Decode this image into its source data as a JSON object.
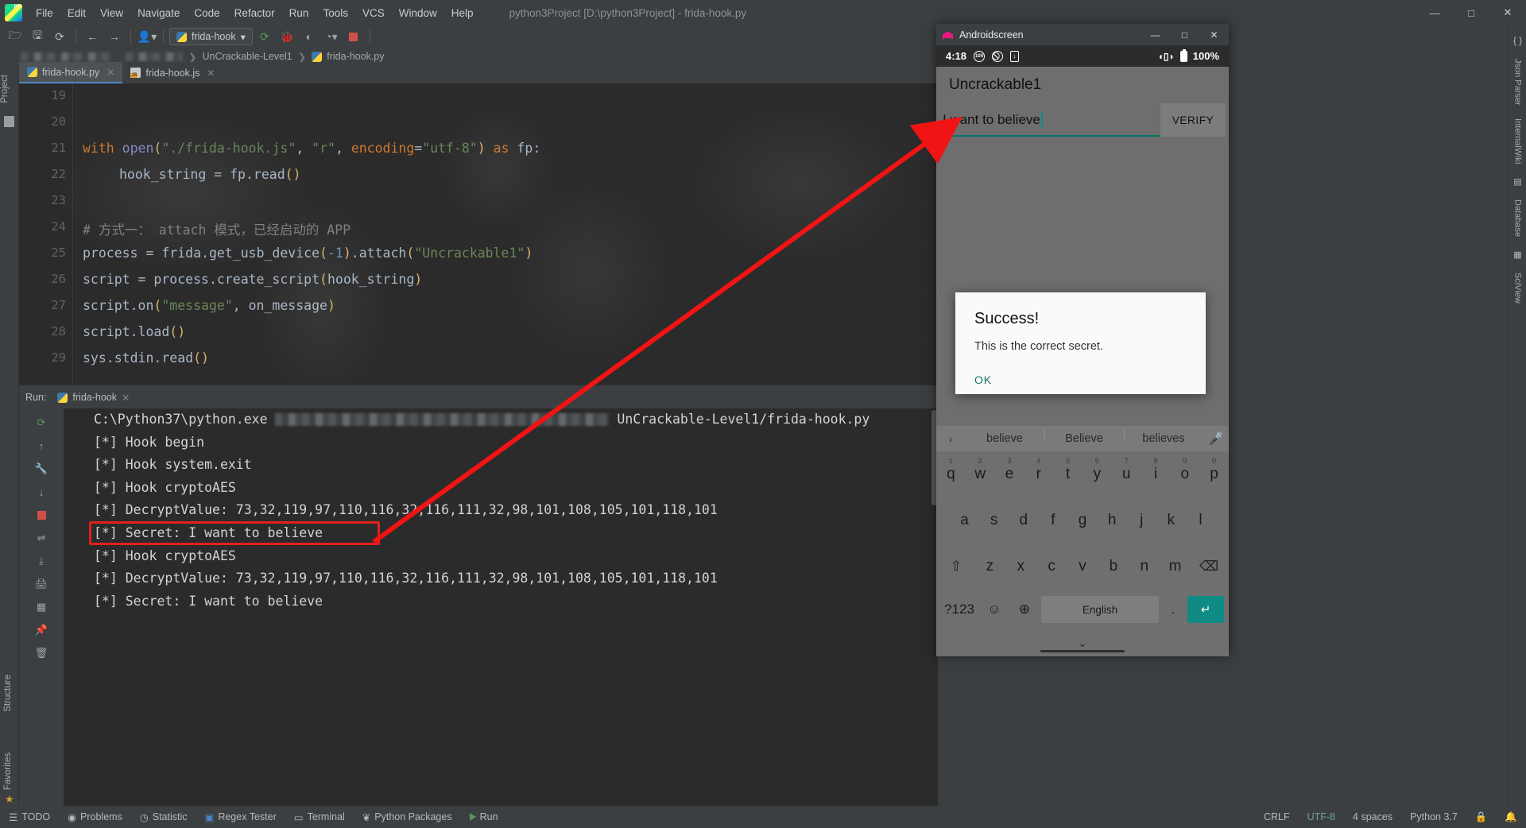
{
  "ide": {
    "window_title": "python3Project [D:\\python3Project] - frida-hook.py",
    "menus": [
      "File",
      "Edit",
      "View",
      "Navigate",
      "Code",
      "Refactor",
      "Run",
      "Tools",
      "VCS",
      "Window",
      "Help"
    ],
    "window_controls": {
      "minimize": "—",
      "maximize": "□",
      "close": "✕"
    },
    "toolbar": {
      "open_icon": "open-folder-icon",
      "save_icon": "save-icon",
      "sync_icon": "sync-icon",
      "back_icon": "←",
      "forward_icon": "→",
      "profile_icon": "▴",
      "run_config_label": "frida-hook",
      "dropdown_caret": "▾",
      "rerun_icon": "↻",
      "debug_icon": "debug-bug-icon",
      "coverage_icon": "coverage-icon",
      "profile_run_icon": "▶",
      "stop_icon": "stop-icon"
    },
    "breadcrumb": {
      "segment": "UnCrackable-Level1",
      "file": "frida-hook.py",
      "separator": "❯"
    },
    "tabs": [
      {
        "label": "frida-hook.py",
        "icon": "python-file-icon",
        "active": true,
        "close": "✕"
      },
      {
        "label": "frida-hook.js",
        "icon": "javascript-file-icon",
        "active": false,
        "close": "✕"
      }
    ],
    "left_strip": {
      "project_label": "Project",
      "structure_label": "Structure",
      "favorites_label": "Favorites"
    },
    "right_strip": [
      "Json Parser",
      "InternalWiki",
      "Database",
      "SciView"
    ],
    "editor": {
      "lines": [
        {
          "no": "19",
          "tokens": []
        },
        {
          "no": "20",
          "tokens": []
        },
        {
          "no": "21",
          "tokens": [
            {
              "t": "with ",
              "c": "k"
            },
            {
              "t": "open",
              "c": "fn"
            },
            {
              "t": "(",
              "c": "par"
            },
            {
              "t": "\"./frida-hook.js\"",
              "c": "s"
            },
            {
              "t": ", ",
              "c": "p"
            },
            {
              "t": "\"r\"",
              "c": "s"
            },
            {
              "t": ", ",
              "c": "p"
            },
            {
              "t": "encoding",
              "c": "k"
            },
            {
              "t": "=",
              "c": "p"
            },
            {
              "t": "\"utf-8\"",
              "c": "s"
            },
            {
              "t": ")",
              "c": "par"
            },
            {
              "t": " ",
              "c": "p"
            },
            {
              "t": "as ",
              "c": "k"
            },
            {
              "t": "fp",
              "c": "p"
            },
            {
              "t": ":",
              "c": "p"
            }
          ]
        },
        {
          "no": "22",
          "indent": 1,
          "tokens": [
            {
              "t": "hook_string ",
              "c": "p"
            },
            {
              "t": "= ",
              "c": "p"
            },
            {
              "t": "fp.read",
              "c": "p"
            },
            {
              "t": "()",
              "c": "par"
            }
          ]
        },
        {
          "no": "23",
          "tokens": []
        },
        {
          "no": "24",
          "tokens": [
            {
              "t": "# 方式一： attach 模式，已经启动的 APP",
              "c": "c"
            }
          ]
        },
        {
          "no": "25",
          "tokens": [
            {
              "t": "process ",
              "c": "p"
            },
            {
              "t": "= ",
              "c": "p"
            },
            {
              "t": "frida.get_usb_device",
              "c": "p"
            },
            {
              "t": "(",
              "c": "par"
            },
            {
              "t": "-1",
              "c": "n"
            },
            {
              "t": ")",
              "c": "par"
            },
            {
              "t": ".attach",
              "c": "p"
            },
            {
              "t": "(",
              "c": "par"
            },
            {
              "t": "\"Uncrackable1\"",
              "c": "s"
            },
            {
              "t": ")",
              "c": "par"
            }
          ]
        },
        {
          "no": "26",
          "tokens": [
            {
              "t": "script ",
              "c": "p"
            },
            {
              "t": "= ",
              "c": "p"
            },
            {
              "t": "process.create_script",
              "c": "p"
            },
            {
              "t": "(",
              "c": "par"
            },
            {
              "t": "hook_string",
              "c": "p"
            },
            {
              "t": ")",
              "c": "par"
            }
          ]
        },
        {
          "no": "27",
          "tokens": [
            {
              "t": "script.on",
              "c": "p"
            },
            {
              "t": "(",
              "c": "par"
            },
            {
              "t": "\"message\"",
              "c": "s"
            },
            {
              "t": ", ",
              "c": "p"
            },
            {
              "t": "on_message",
              "c": "p"
            },
            {
              "t": ")",
              "c": "par"
            }
          ]
        },
        {
          "no": "28",
          "tokens": [
            {
              "t": "script.load",
              "c": "p"
            },
            {
              "t": "()",
              "c": "par"
            }
          ]
        },
        {
          "no": "29",
          "tokens": [
            {
              "t": "sys.stdin.read",
              "c": "p"
            },
            {
              "t": "()",
              "c": "par"
            }
          ]
        }
      ]
    },
    "run_panel": {
      "label": "Run:",
      "tab_label": "frida-hook",
      "tab_close": "✕",
      "tool_icons": [
        "rerun-icon",
        "scroll-up-icon",
        "wrench-icon",
        "scroll-down-icon",
        "stop-icon",
        "soft-wrap-icon",
        "scroll-to-end-icon",
        "print-icon",
        "layout-icon",
        "pin-icon",
        "trash-icon"
      ],
      "console_lines": [
        {
          "text": "C:\\Python37\\python.exe ",
          "blurred": true,
          "tail": "UnCrackable-Level1/frida-hook.py"
        },
        {
          "text": "[*] Hook begin"
        },
        {
          "text": "[*] Hook system.exit"
        },
        {
          "text": "[*] Hook cryptoAES"
        },
        {
          "text": "[*] DecryptValue: 73,32,119,97,110,116,32,116,111,32,98,101,108,105,101,118,101"
        },
        {
          "text": "[*] Secret: I want to believe",
          "highlight": true
        },
        {
          "text": "[*] Hook cryptoAES"
        },
        {
          "text": "[*] DecryptValue: 73,32,119,97,110,116,32,116,111,32,98,101,108,105,101,118,101"
        },
        {
          "text": "[*] Secret: I want to believe"
        }
      ],
      "highlight_color": "#e41f1f"
    },
    "status_bar": {
      "todo": "TODO",
      "problems": "Problems",
      "statistic": "Statistic",
      "regex_tester": "Regex Tester",
      "terminal": "Terminal",
      "python_packages": "Python Packages",
      "run": "Run",
      "line_sep": "CRLF",
      "encoding": "UTF-8",
      "indent": "4 spaces",
      "interpreter": "Python 3.7",
      "lock_icon": "lock-icon",
      "notification_icon": "bell-icon"
    }
  },
  "android": {
    "window_title": "Androidscreen",
    "window_controls": {
      "minimize": "—",
      "maximize": "□",
      "close": "✕"
    },
    "status_bar": {
      "time": "4:18",
      "icons": [
        "dnd-100-icon",
        "no-signal-icon",
        "download-icon"
      ],
      "vibrate_icon": "vibrate-icon",
      "battery": "100%"
    },
    "app_title": "Uncrackable1",
    "input": {
      "value": "I want to believe",
      "caret_color": "#009688",
      "underline_color": "#00796b"
    },
    "verify_button": "VERIFY",
    "dialog": {
      "title": "Success!",
      "message": "This is the correct secret.",
      "ok_label": "OK"
    },
    "keyboard": {
      "suggestions": [
        "believe",
        "Believe",
        "believes"
      ],
      "expand_icon": "›",
      "mic_icon": "mic-icon",
      "row1": [
        {
          "k": "q",
          "n": "1"
        },
        {
          "k": "w",
          "n": "2"
        },
        {
          "k": "e",
          "n": "3"
        },
        {
          "k": "r",
          "n": "4"
        },
        {
          "k": "t",
          "n": "5"
        },
        {
          "k": "y",
          "n": "6"
        },
        {
          "k": "u",
          "n": "7"
        },
        {
          "k": "i",
          "n": "8"
        },
        {
          "k": "o",
          "n": "9"
        },
        {
          "k": "p",
          "n": "0"
        }
      ],
      "row2": [
        "a",
        "s",
        "d",
        "f",
        "g",
        "h",
        "j",
        "k",
        "l"
      ],
      "row3": {
        "shift": "⇧",
        "keys": [
          "z",
          "x",
          "c",
          "v",
          "b",
          "n",
          "m"
        ],
        "backspace": "⌫"
      },
      "row4": {
        "symbols": "?123",
        "emoji": "☺",
        "globe": "⊕",
        "space_label": "English",
        "period": ".",
        "enter": "↵"
      },
      "nav_down": "⌄"
    }
  }
}
